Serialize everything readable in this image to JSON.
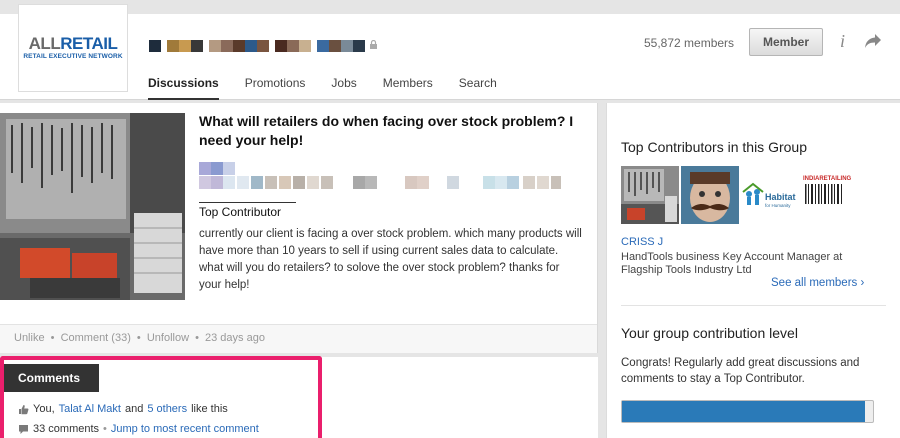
{
  "header": {
    "logo": {
      "main_all": "ALL",
      "main_retail": "RETAIL",
      "sub": "RETAIL EXECUTIVE NETWORK"
    },
    "members_count": "55,872 members",
    "member_button": "Member",
    "icons": {
      "info": "info-icon",
      "share": "share-icon",
      "lock": "lock-icon"
    },
    "nav": [
      "Discussions",
      "Promotions",
      "Jobs",
      "Members",
      "Search"
    ]
  },
  "post": {
    "title": "What will retailers do when facing over stock problem? I need your help!",
    "author_badge": "Top Contributor",
    "body_lines": [
      "currently our client is facing a over stock problem. which many products will have more than 10 years to sell if using current sales data to calculate.",
      "what will you do retailers? to solove the over stock problem? thanks for your help!"
    ],
    "actions": {
      "unlike": "Unlike",
      "comment": "Comment (33)",
      "unfollow": "Unfollow",
      "age": "23 days ago"
    }
  },
  "comments": {
    "tab_label": "Comments",
    "likes_prefix": "You,",
    "likes_person": "Talat Al Makt",
    "likes_and": "and",
    "likes_others": "5 others",
    "likes_suffix": "like this",
    "count": "33 comments",
    "jump_link": "Jump to most recent comment"
  },
  "sidebar": {
    "top_title": "Top Contributors in this Group",
    "contributor_name": "CRISS J",
    "contributor_desc": "HandTools business Key Account Manager at Flagship Tools Industry Ltd",
    "see_all": "See all members",
    "contrib_title": "Your group contribution level",
    "contrib_text": "Congrats! Regularly add great discussions and comments to stay a Top Contributor.",
    "contrib_progress": 0.97
  },
  "colors": {
    "accent_link": "#2a6ab8",
    "highlight_border": "#ea1f6c",
    "progress_fill": "#2a7ab8",
    "comments_tab_bg": "#333333"
  }
}
